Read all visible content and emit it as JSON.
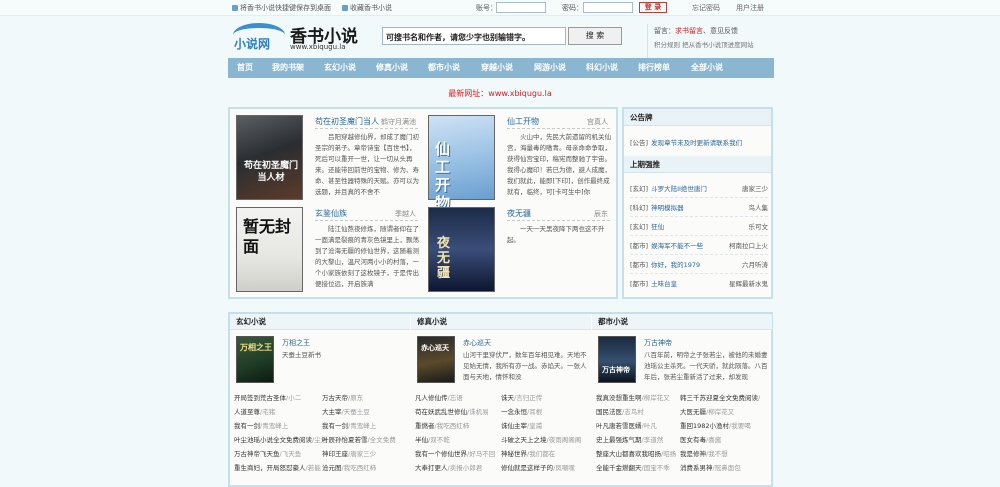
{
  "topbar": {
    "shortcut": "将香书小说快捷键保存到桌面",
    "bookmark": "收藏香书小说",
    "account_label": "账号：",
    "password_label": "密码：",
    "login_button": "登 录",
    "forgot": "忘记密码",
    "register": "用户注册"
  },
  "logo": {
    "title": "香书小说",
    "url": "www.xbiqugu.la",
    "small": "小说网"
  },
  "search": {
    "placeholder": "可搜书名和作者，请您少字也别输错字。",
    "button": "搜 索"
  },
  "notice": {
    "prefix": "留言：",
    "red": "求书留言",
    "sep": "、",
    "feedback": "意见反馈",
    "line2": "积分规则 把从香书小说顶进度网站"
  },
  "nav": [
    "首页",
    "我的书架",
    "玄幻小说",
    "修真小说",
    "都市小说",
    "穿越小说",
    "网游小说",
    "科幻小说",
    "排行榜单",
    "全部小说"
  ],
  "new_url": "最新网址：www.xbiqugu.la",
  "featured": [
    {
      "title": "苟在初圣魔门当人",
      "author": "鹤守月满池",
      "cover_text": "苟在初圣魔门当人材",
      "desc": "吕阳穿越修仙界，却成了魔门初圣宗的弟子。章帝诗宝【百世书】，死后可以重开一世，让一切从头再来。还能带回前世的宝物、修为、寿命、甚至性器特殊的天赋。亦可以为选题，并且真的不舍不"
    },
    {
      "title": "仙工开物",
      "author": "宫真人",
      "cover_text": "仙工开物",
      "desc": "火山中，先民大前遗留的机关仙宫，海量毒的嗷青。母亲命命争取，获得仙宫宝印，稿宪而整驰了宇宙。我得心魔印！若已为德，避人成魔，我们就此，能即[下印]，创作最终成就有，临终，可[卡可生中]你"
    },
    {
      "title": "玄鉴仙族",
      "author": "季越人",
      "cover_text": "暂无封面",
      "desc": "陆江仙熬夜修炼，随谓者仰在了一面满是裂痕的青灰色镜里上，飘荡到了沧海无疆的修仙世界，这随着测的大黎山，温尺河两小小的村落，一个小家族依刻了这枚镜子，于是传出便接位远，开启族满"
    },
    {
      "title": "夜无疆",
      "author": "辰东",
      "cover_text": "夜无疆",
      "desc": "一天一天黑夜降下两也这不升起。"
    }
  ],
  "announcement": {
    "header": "公告牌",
    "items": [
      {
        "cat": "[公告]",
        "title": "发现章节未及时更新请联系我们"
      }
    ]
  },
  "latest": {
    "header": "上期强推",
    "items": [
      {
        "cat": "[玄幻]",
        "title": "斗罗大陆II绝世唐门",
        "author": "唐家三少"
      },
      {
        "cat": "[科幻]",
        "title": "神明模拟器",
        "author": "鸟人集"
      },
      {
        "cat": "[玄幻]",
        "title": "狂仙",
        "author": "乐可文"
      },
      {
        "cat": "[都市]",
        "title": "娱海军不能不一些",
        "author": "柯南拉口上火"
      },
      {
        "cat": "[都市]",
        "title": "你好，我的1979",
        "author": "六月听涛"
      },
      {
        "cat": "[都市]",
        "title": "土味台皇",
        "author": "星辉最新水鬼"
      }
    ]
  },
  "columns": [
    {
      "header": "玄幻小说",
      "cover_text": "万相之王",
      "feature_title": "万相之王",
      "feature_desc": "天蚕土豆新书",
      "rows": [
        [
          "开局签到荒古圣体",
          "/小二",
          "万古天帝",
          "/原东"
        ],
        [
          "人道至尊",
          "/宅猪",
          "大主宰",
          "/天蚕土豆"
        ],
        [
          "我有一剑",
          "/青鸾峰上",
          "我有一剑",
          "/青鸾峰上"
        ],
        [
          "叶尘池瑶小说全文免费阅读",
          "/尘池",
          "叶辰孙怡夏若雪",
          "/全文免费"
        ],
        [
          "万古神帝飞天鱼",
          "/飞天鱼",
          "神印王座",
          "/唐家三少"
        ],
        [
          "重生商妇，开局怒怼豪人",
          "/若能",
          "沧元图",
          "/我吃西红柿"
        ]
      ]
    },
    {
      "header": "修真小说",
      "cover_text": "赤心巡天",
      "feature_title": "赤心巡天",
      "feature_desc": "山河干里穿伏尸，数年百年相见难。天地不见始无情，我所有亦一战。赤焰天。一张人面与天地，情怀和没",
      "rows": [
        [
          "凡人修仙传",
          "/忘语",
          "诛天",
          "/言归正传"
        ],
        [
          "苟在妖武乱世修仙",
          "/诛机易",
          "一念永恒",
          "/耳根"
        ],
        [
          "重燃者",
          "/我吃西红柿",
          "诛仙主宰",
          "/皇甫"
        ],
        [
          "半仙",
          "/双不乾",
          "斗破之天上之境",
          "/夜雨阁阁阁"
        ],
        [
          "我有一个修仙世界",
          "/好马不回",
          "神秘世界",
          "/我们都在"
        ],
        [
          "大奉打更人",
          "/卖报小郎君",
          "修仙就是这样子的",
          "/凤嘲嘿"
        ]
      ]
    },
    {
      "header": "都市小说",
      "cover_text": "万古神帝",
      "feature_title": "万古神帝",
      "feature_desc": "八百年前，明帝之子张若尘，被他的未婚妻池瑶公主杀死。一代天骄，就此陨落。八百年后，张若尘重新活了过来，却发现",
      "rows": [
        [
          "我真没想重生啊",
          "/柳岸花又",
          "韩三千苏迎夏全文免费阅读",
          "/"
        ],
        [
          "国民法医",
          "/志鸟村",
          "大医无疆",
          "/柳岸花又"
        ],
        [
          "叶凡唐若雪医婿",
          "/叶凡",
          "重回1982小渔村",
          "/我要喝"
        ],
        [
          "史上最强炼气期",
          "/李道然",
          "医女有毒",
          "/喜酱"
        ],
        [
          "整座大山都喜欢我昭扬",
          "/昭扬",
          "我是修神",
          "/我不想"
        ],
        [
          "全能千金燃翻天",
          "/国宝不乖",
          "消费系男神",
          "/冠鼻面包"
        ]
      ]
    }
  ],
  "colors": {
    "nav": "#8ab6d2",
    "panel_border": "#c6dfed",
    "link": "#2a67a0",
    "red": "#e01a1a"
  }
}
